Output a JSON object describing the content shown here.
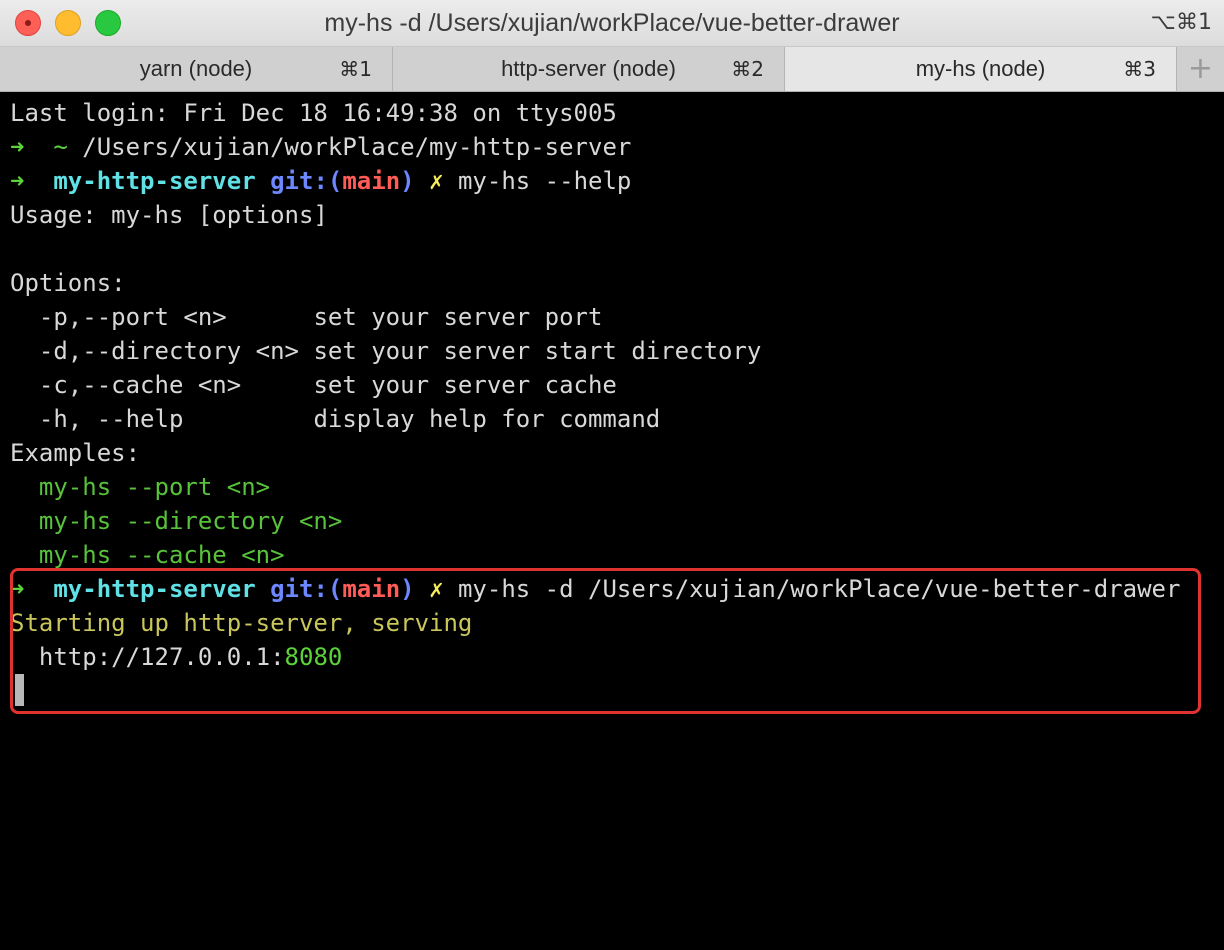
{
  "window": {
    "title": "my-hs -d /Users/xujian/workPlace/vue-better-drawer",
    "shortcut": "⌥⌘1"
  },
  "tabs": [
    {
      "label": "yarn (node)",
      "shortcut": "⌘1",
      "active": false
    },
    {
      "label": "http-server (node)",
      "shortcut": "⌘2",
      "active": false
    },
    {
      "label": "my-hs (node)",
      "shortcut": "⌘3",
      "active": true
    }
  ],
  "tab_add_label": "+",
  "terminal": {
    "last_login": "Last login: Fri Dec 18 16:49:38 on ttys005",
    "prompt_arrow": "➜",
    "home_tilde": "~",
    "line2_path": "/Users/xujian/workPlace/my-http-server",
    "dir_name": "my-http-server",
    "git_prefix": "git:(",
    "git_branch": "main",
    "git_suffix": ")",
    "dirty_mark": "✗",
    "cmd_help": "my-hs --help",
    "usage": "Usage: my-hs [options]",
    "options_header": "Options:",
    "options": [
      {
        "flag": "  -p,--port <n>      ",
        "desc": "set your server port"
      },
      {
        "flag": "  -d,--directory <n> ",
        "desc": "set your server start directory"
      },
      {
        "flag": "  -c,--cache <n>     ",
        "desc": "set your server cache"
      },
      {
        "flag": "  -h, --help         ",
        "desc": "display help for command"
      }
    ],
    "examples_header": "Examples:",
    "examples": [
      "  my-hs --port <n>",
      "  my-hs --directory <n>",
      "  my-hs --cache <n>"
    ],
    "cmd_d": "my-hs -d /Users/xujian/workPlace/vue-better-drawer",
    "starting": "Starting up http-server, serving",
    "url_prefix": "  http://127.0.0.1:",
    "url_port": "8080"
  },
  "colors": {
    "highlight_border": "#e0332f",
    "prompt_green": "#5cd33a",
    "dir_cyan": "#5fe1e6",
    "git_blue": "#6c87ff",
    "branch_red": "#ff5c57",
    "dirty_yellow": "#f8ec5c"
  }
}
